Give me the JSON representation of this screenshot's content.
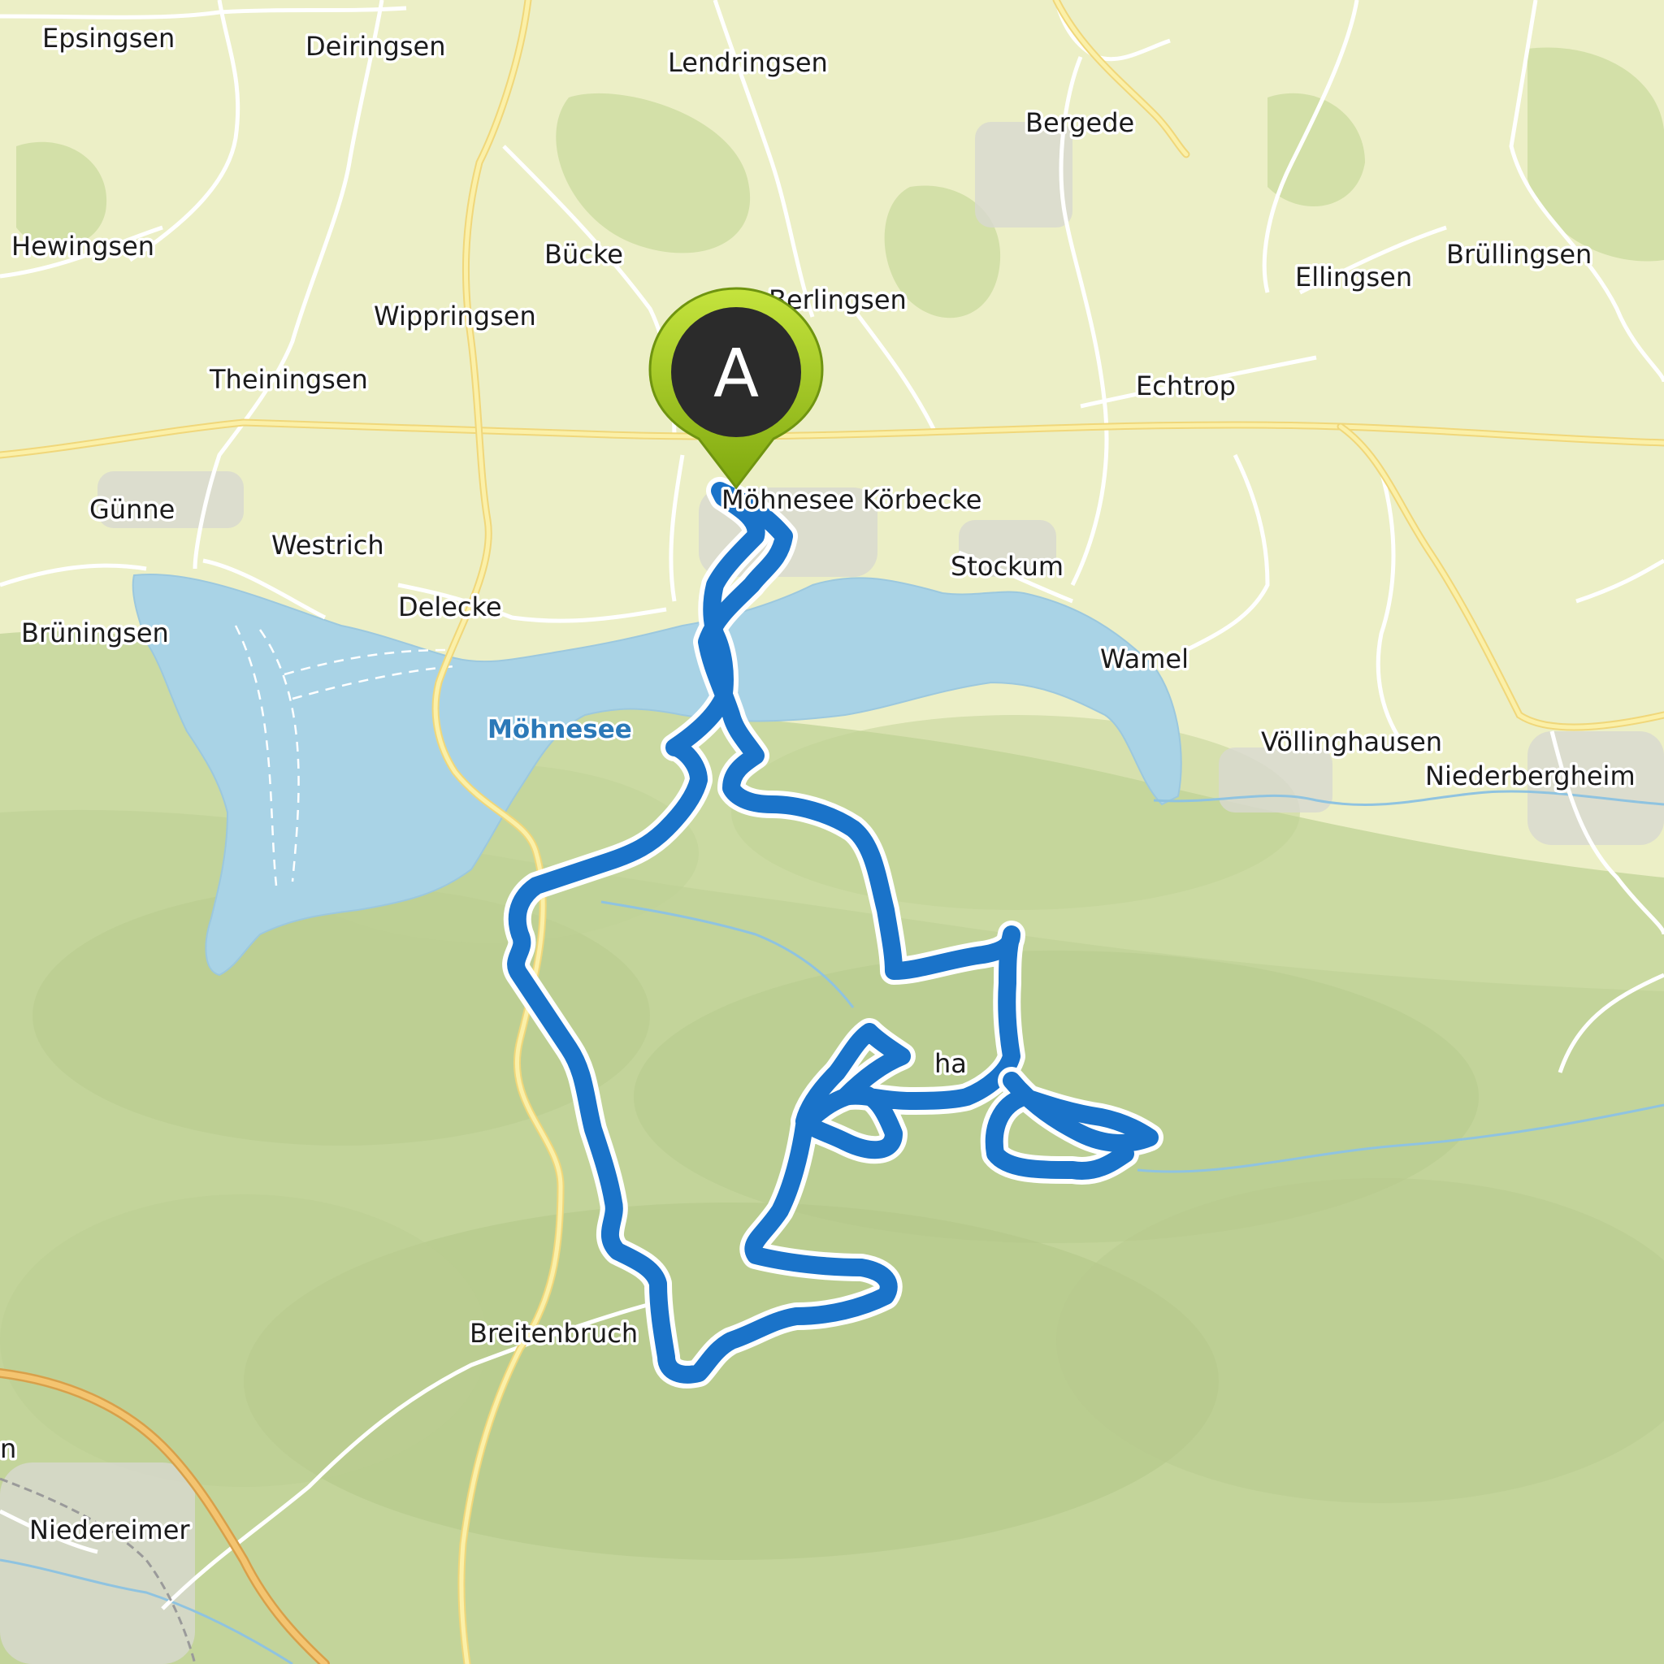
{
  "map": {
    "places": [
      {
        "id": "epsingsen",
        "name": "Epsingsen"
      },
      {
        "id": "deiringsen",
        "name": "Deiringsen"
      },
      {
        "id": "lendringsen",
        "name": "Lendringsen"
      },
      {
        "id": "bergede",
        "name": "Bergede"
      },
      {
        "id": "hewingsen",
        "name": "Hewingsen"
      },
      {
        "id": "buecke",
        "name": "Bücke"
      },
      {
        "id": "berlingsen",
        "name": "Berlingsen"
      },
      {
        "id": "ellingsen",
        "name": "Ellingsen"
      },
      {
        "id": "bruellingsen",
        "name": "Brüllingsen"
      },
      {
        "id": "wippringsen",
        "name": "Wippringsen"
      },
      {
        "id": "theiningsen",
        "name": "Theiningsen"
      },
      {
        "id": "echtrop",
        "name": "Echtrop"
      },
      {
        "id": "guenne",
        "name": "Günne"
      },
      {
        "id": "moehnesee-koerbecke",
        "name": "Möhnesee Körbecke"
      },
      {
        "id": "westrich",
        "name": "Westrich"
      },
      {
        "id": "stockum",
        "name": "Stockum"
      },
      {
        "id": "delecke",
        "name": "Delecke"
      },
      {
        "id": "brueningsen",
        "name": "Brüningsen"
      },
      {
        "id": "wamel",
        "name": "Wamel"
      },
      {
        "id": "voellinghausen",
        "name": "Völlinghausen"
      },
      {
        "id": "niederbergheim",
        "name": "Niederbergheim"
      },
      {
        "id": "breitenbruch",
        "name": "Breitenbruch"
      },
      {
        "id": "niedereimer",
        "name": "Niedereimer"
      },
      {
        "id": "ha",
        "name": "ha"
      },
      {
        "id": "edge-n",
        "name": "n"
      }
    ],
    "lake_name": "Möhnesee",
    "start_marker": {
      "letter": "A"
    },
    "route_color": "#1a73c9",
    "marker_color": "#9bc61a"
  }
}
